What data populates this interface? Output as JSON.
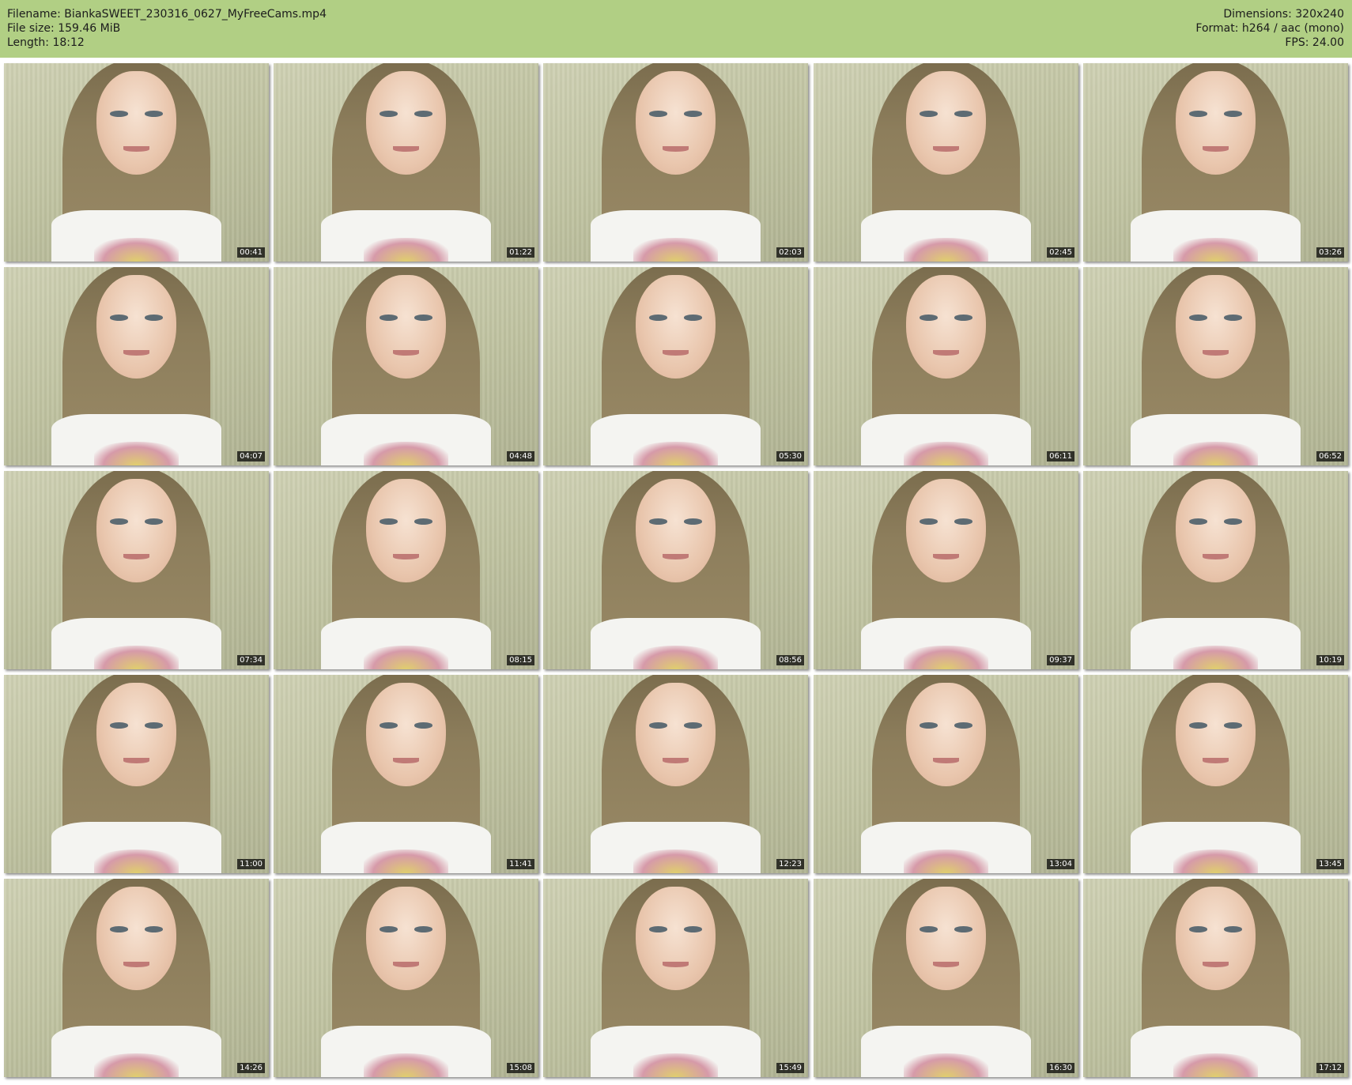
{
  "header": {
    "filename": "Filename: BiankaSWEET_230316_0627_MyFreeCams.mp4",
    "filesize": "File size: 159.46 MiB",
    "length": "Length: 18:12",
    "dimensions": "Dimensions: 320x240",
    "format": "Format: h264 / aac (mono)",
    "fps": "FPS: 24.00"
  },
  "colors": {
    "header_bg": "#b1cf84",
    "page_bg": "#ffffff"
  },
  "thumbnails": [
    {
      "time": "00:41"
    },
    {
      "time": "01:22"
    },
    {
      "time": "02:03"
    },
    {
      "time": "02:45"
    },
    {
      "time": "03:26"
    },
    {
      "time": "04:07"
    },
    {
      "time": "04:48"
    },
    {
      "time": "05:30"
    },
    {
      "time": "06:11"
    },
    {
      "time": "06:52"
    },
    {
      "time": "07:34"
    },
    {
      "time": "08:15"
    },
    {
      "time": "08:56"
    },
    {
      "time": "09:37"
    },
    {
      "time": "10:19"
    },
    {
      "time": "11:00"
    },
    {
      "time": "11:41"
    },
    {
      "time": "12:23"
    },
    {
      "time": "13:04"
    },
    {
      "time": "13:45"
    },
    {
      "time": "14:26"
    },
    {
      "time": "15:08"
    },
    {
      "time": "15:49"
    },
    {
      "time": "16:30"
    },
    {
      "time": "17:12"
    }
  ]
}
